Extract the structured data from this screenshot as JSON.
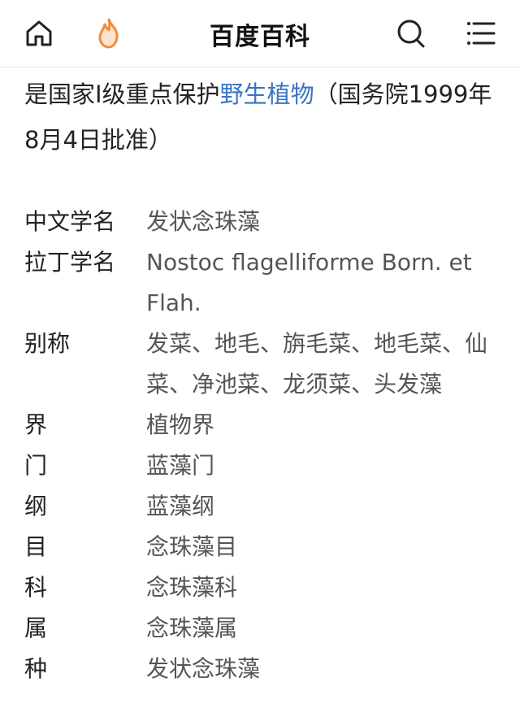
{
  "header": {
    "title": "百度百科",
    "icons": [
      "home-icon",
      "flame-icon",
      "search-icon",
      "menu-icon"
    ],
    "accent": "#f08a3e"
  },
  "intro": {
    "before_link": "是国家I级重点保护",
    "link": "野生植物",
    "after_link": "（国务院1999年8月4日批准）",
    "link_color": "#3a74c4"
  },
  "infobox": {
    "rows": [
      {
        "label": "中文学名",
        "value": "发状念珠藻"
      },
      {
        "label": "拉丁学名",
        "value": "Nostoc flagelliforme Born. et Flah."
      },
      {
        "label": "别称",
        "value": "发菜、地毛、旃毛菜、地毛菜、仙菜、净池菜、龙须菜、头发藻"
      },
      {
        "label": "界",
        "value": "植物界"
      },
      {
        "label": "门",
        "value": "蓝藻门"
      },
      {
        "label": "纲",
        "value": "蓝藻纲"
      },
      {
        "label": "目",
        "value": "念珠藻目"
      },
      {
        "label": "科",
        "value": "念珠藻科"
      },
      {
        "label": "属",
        "value": "念珠藻属"
      },
      {
        "label": "种",
        "value": "发状念珠藻"
      }
    ]
  }
}
